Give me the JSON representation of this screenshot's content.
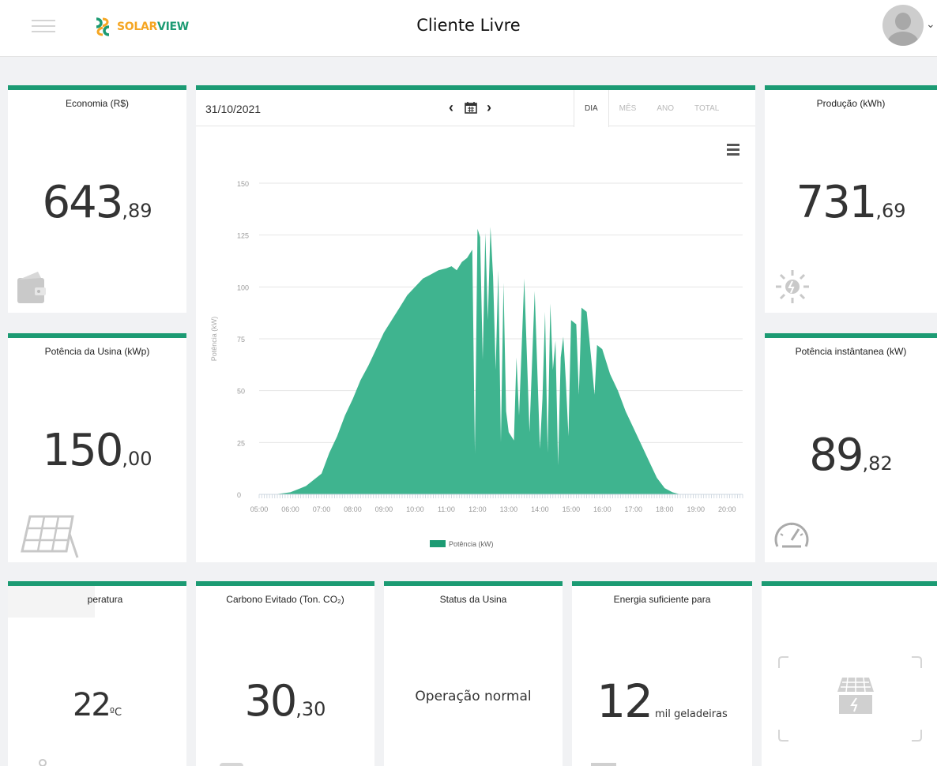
{
  "header": {
    "logo_text_solar": "SOLAR",
    "logo_text_view": "VIEW",
    "title": "Cliente Livre"
  },
  "colors": {
    "accent": "#1c9b73",
    "chart_fill": "#3fb48f",
    "logo_orange": "#f5a623"
  },
  "cards": {
    "economia": {
      "title": "Economia (R$)",
      "int": "643",
      "dec": ",89",
      "icon": "wallet-icon"
    },
    "potencia_usina": {
      "title": "Potência da Usina (kWp)",
      "int": "150",
      "dec": ",00",
      "icon": "solar-panel-icon"
    },
    "producao": {
      "title": "Produção (kWh)",
      "int": "731",
      "dec": ",69",
      "icon": "sun-icon"
    },
    "potencia_instantanea": {
      "title": "Potência instântanea (kW)",
      "int": "89",
      "dec": ",82",
      "icon": "speedometer-icon"
    },
    "temperatura": {
      "title": "peratura",
      "int": "22",
      "unit": "ºC",
      "icon": "thermometer-icon"
    },
    "carbono": {
      "title": "Carbono Evitado (Ton. CO₂)",
      "int": "30",
      "dec": ",30",
      "icon": "leaf-icon"
    },
    "status": {
      "title": "Status da Usina",
      "text": "Operação normal",
      "icon": "status-icon"
    },
    "energia": {
      "title": "Energia suficiente para",
      "int": "12",
      "unit": "mil geladeiras",
      "icon": "fridge-icon"
    },
    "imagem": {
      "icon": "solar-house-icon"
    }
  },
  "chart_panel": {
    "date": "31/10/2021",
    "tabs": [
      "DIA",
      "MÊS",
      "ANO",
      "TOTAL"
    ],
    "active_tab": "DIA"
  },
  "chart_data": {
    "type": "area",
    "title": "",
    "xlabel": "",
    "ylabel": "Potência (kW)",
    "ylim": [
      0,
      150
    ],
    "yticks": [
      "0",
      "25",
      "50",
      "75",
      "100",
      "125",
      "150"
    ],
    "xticks": [
      "05:00",
      "06:00",
      "07:00",
      "08:00",
      "09:00",
      "10:00",
      "11:00",
      "12:00",
      "13:00",
      "14:00",
      "15:00",
      "16:00",
      "17:00",
      "18:00",
      "19:00",
      "20:00"
    ],
    "legend_placement": "bottom",
    "grid": true,
    "series": [
      {
        "name": "Potência (kW)",
        "x": [
          "05:00",
          "05:30",
          "06:00",
          "06:30",
          "07:00",
          "07:15",
          "07:30",
          "07:45",
          "08:00",
          "08:15",
          "08:30",
          "08:45",
          "09:00",
          "09:15",
          "09:30",
          "09:45",
          "10:00",
          "10:15",
          "10:30",
          "10:45",
          "11:00",
          "11:10",
          "11:20",
          "11:30",
          "11:40",
          "11:50",
          "11:55",
          "12:00",
          "12:05",
          "12:10",
          "12:15",
          "12:20",
          "12:25",
          "12:30",
          "12:35",
          "12:40",
          "12:45",
          "12:50",
          "12:55",
          "13:00",
          "13:10",
          "13:15",
          "13:20",
          "13:30",
          "13:40",
          "13:50",
          "14:00",
          "14:05",
          "14:10",
          "14:15",
          "14:20",
          "14:25",
          "14:30",
          "14:35",
          "14:40",
          "14:45",
          "14:50",
          "14:55",
          "15:00",
          "15:10",
          "15:15",
          "15:20",
          "15:30",
          "15:40",
          "15:45",
          "15:50",
          "16:00",
          "16:15",
          "16:30",
          "16:45",
          "17:00",
          "17:15",
          "17:30",
          "17:45",
          "18:00",
          "18:15",
          "18:30",
          "18:45",
          "19:00",
          "19:30",
          "20:00"
        ],
        "values": [
          0,
          0,
          1,
          4,
          10,
          20,
          28,
          38,
          46,
          55,
          62,
          70,
          78,
          84,
          90,
          96,
          100,
          104,
          106,
          108,
          109,
          110,
          108,
          112,
          114,
          118,
          20,
          128,
          124,
          65,
          126,
          84,
          129,
          105,
          60,
          108,
          25,
          102,
          40,
          30,
          26,
          66,
          38,
          104,
          30,
          98,
          22,
          46,
          88,
          20,
          92,
          60,
          74,
          14,
          66,
          76,
          54,
          28,
          84,
          82,
          48,
          90,
          88,
          62,
          48,
          72,
          70,
          58,
          50,
          40,
          32,
          24,
          16,
          8,
          3,
          1,
          0,
          0,
          0,
          0,
          0
        ]
      }
    ]
  }
}
